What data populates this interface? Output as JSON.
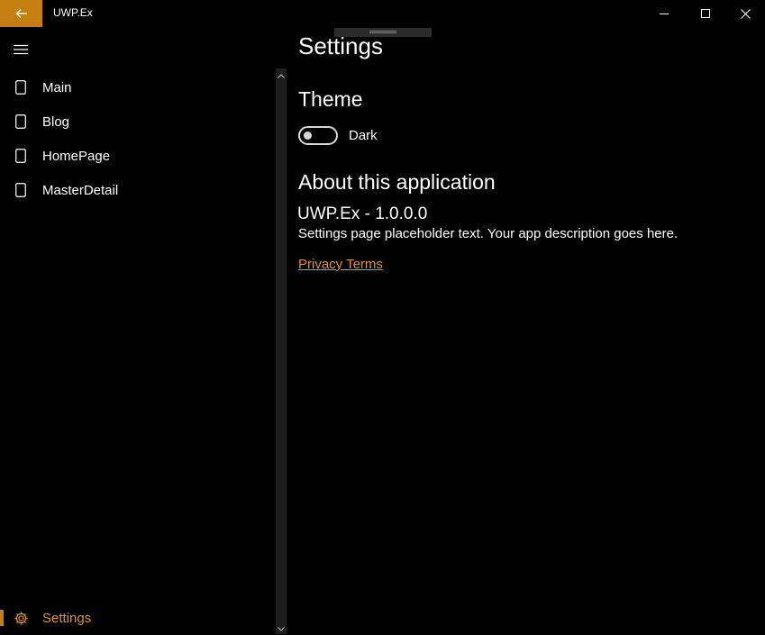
{
  "window": {
    "title": "UWP.Ex",
    "accent_color": "#c47f13",
    "controls": [
      "minimize-icon",
      "maximize-icon",
      "close-icon"
    ]
  },
  "nav": {
    "menu_icon": "hamburger-icon",
    "items": [
      {
        "label": "Main",
        "icon": "page-icon"
      },
      {
        "label": "Blog",
        "icon": "page-icon"
      },
      {
        "label": "HomePage",
        "icon": "page-icon"
      },
      {
        "label": "MasterDetail",
        "icon": "page-icon"
      }
    ],
    "settings": {
      "label": "Settings",
      "icon": "gear-icon",
      "selected": true
    }
  },
  "settings_page": {
    "title": "Settings",
    "theme_heading": "Theme",
    "theme_toggle": {
      "label": "Dark",
      "on": false
    },
    "about_heading": "About this application",
    "version": "UWP.Ex - 1.0.0.0",
    "description": "Settings page placeholder text.  Your app description goes here.",
    "privacy_link": "Privacy Terms"
  }
}
